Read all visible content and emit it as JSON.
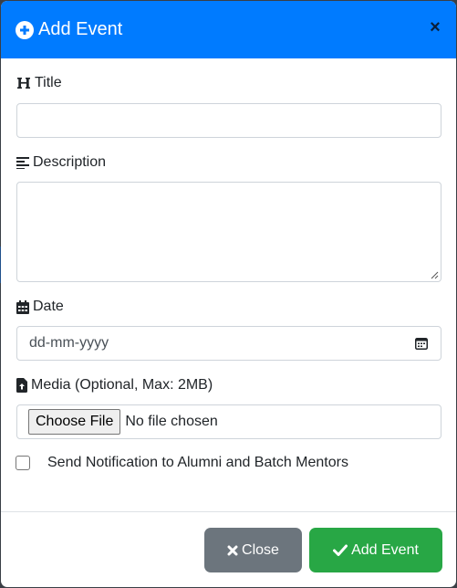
{
  "modal": {
    "title": "Add Event",
    "header_icon": "plus-circle-icon",
    "close_glyph": "×"
  },
  "form": {
    "title_label": "Title",
    "title_value": "",
    "description_label": "Description",
    "description_value": "",
    "date_label": "Date",
    "date_placeholder": "dd-mm-yyyy",
    "media_label": "Media (Optional, Max: 2MB)",
    "choose_file_label": "Choose File",
    "file_status": "No file chosen",
    "notify_label": "Send Notification to Alumni and Batch Mentors",
    "notify_checked": false
  },
  "footer": {
    "close_label": "Close",
    "add_label": "Add Event"
  },
  "colors": {
    "header": "#007bff",
    "close_button": "#6c757d",
    "add_button": "#28a745"
  }
}
